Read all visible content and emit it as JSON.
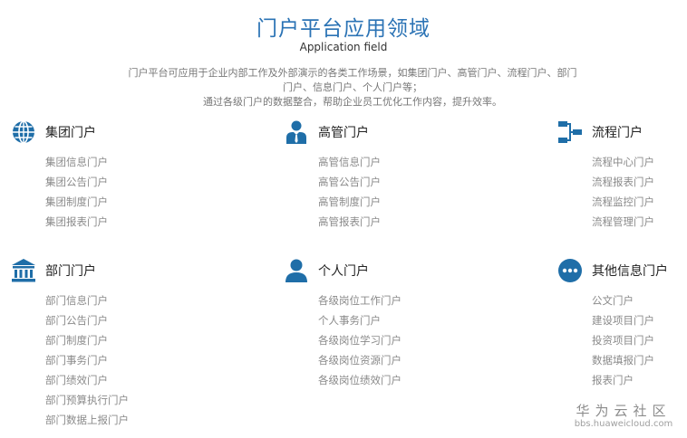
{
  "header": {
    "title": "门户平台应用领域",
    "subtitle": "Application field",
    "intro": [
      "门户平台可应用于企业内部工作及外部演示的各类工作场景，如集团门户、高管门户、流程门户、部门",
      "门户、信息门户、个人门户等；",
      "通过各级门户的数据整合，帮助企业员工优化工作内容，提升效率。"
    ]
  },
  "accent_color": "#1f6ea8",
  "categories": [
    {
      "icon": "globe-icon",
      "title": "集团门户",
      "items": [
        "集团信息门户",
        "集团公告门户",
        "集团制度门户",
        "集团报表门户"
      ]
    },
    {
      "icon": "executive-person-icon",
      "title": "高管门户",
      "items": [
        "高管信息门户",
        "高管公告门户",
        "高管制度门户",
        "高管报表门户"
      ]
    },
    {
      "icon": "workflow-icon",
      "title": "流程门户",
      "items": [
        "流程中心门户",
        "流程报表门户",
        "流程监控门户",
        "流程管理门户"
      ]
    },
    {
      "icon": "institution-building-icon",
      "title": "部门门户",
      "items": [
        "部门信息门户",
        "部门公告门户",
        "部门制度门户",
        "部门事务门户",
        "部门绩效门户",
        "部门预算执行门户",
        "部门数据上报门户"
      ]
    },
    {
      "icon": "person-icon",
      "title": "个人门户",
      "items": [
        "各级岗位工作门户",
        "个人事务门户",
        "各级岗位学习门户",
        "各级岗位资源门户",
        "各级岗位绩效门户"
      ]
    },
    {
      "icon": "more-dots-icon",
      "title": "其他信息门户",
      "items": [
        "公文门户",
        "建设项目门户",
        "投资项目门户",
        "数据填报门户",
        "报表门户"
      ]
    }
  ],
  "watermark": {
    "name": "华为云社区",
    "url": "bbs.huaweicloud.com"
  }
}
